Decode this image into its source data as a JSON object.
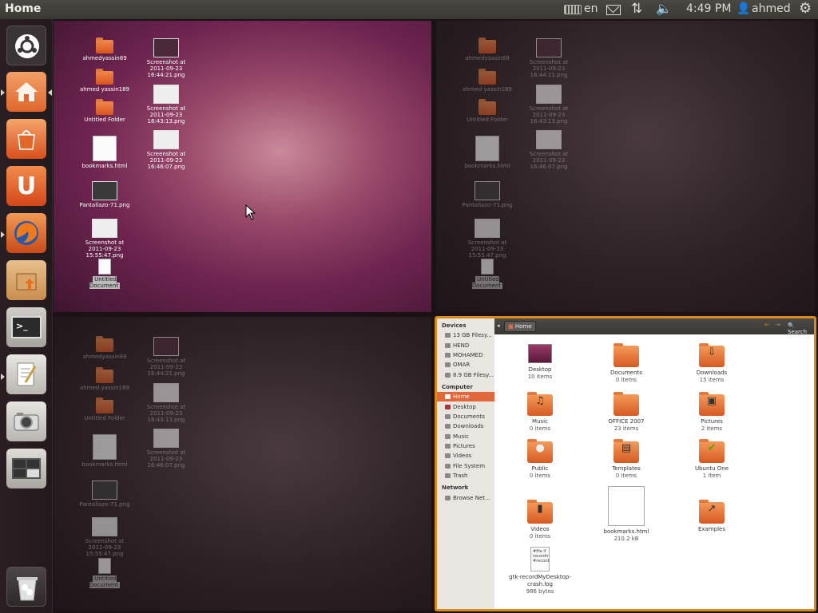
{
  "panel": {
    "title": "Home",
    "keyboard_layout": "en",
    "time": "4:49 PM",
    "user": "ahmed"
  },
  "launcher": {
    "items": [
      {
        "name": "ubuntu-logo"
      },
      {
        "name": "home-folder"
      },
      {
        "name": "software-center"
      },
      {
        "name": "ubuntu-one"
      },
      {
        "name": "firefox"
      },
      {
        "name": "archive-manager"
      },
      {
        "name": "terminal"
      },
      {
        "name": "text-editor"
      },
      {
        "name": "cheese-webcam"
      },
      {
        "name": "workspace-switcher"
      },
      {
        "name": "trash"
      }
    ]
  },
  "desktop": {
    "icons": [
      {
        "label": "ahmedyassin89",
        "kind": "folder"
      },
      {
        "label": "ahmed yassin189",
        "kind": "folder"
      },
      {
        "label": "Untitled Folder",
        "kind": "folder"
      },
      {
        "label": "bookmarks.html",
        "kind": "doc"
      },
      {
        "label": "Pantallazo-71.png",
        "kind": "image"
      },
      {
        "label": "Screenshot at 2011-09-23 15:55:47.png",
        "kind": "image"
      },
      {
        "label": "Untitled Document",
        "kind": "text"
      },
      {
        "label": "Screenshot at 2011-09-23 16:44:21.png",
        "kind": "image"
      },
      {
        "label": "Screenshot at 2011-09-23 16:43:13.png",
        "kind": "image"
      },
      {
        "label": "Screenshot at 2011-09-23 16:46:07.png",
        "kind": "image"
      }
    ]
  },
  "file_manager": {
    "sidebar": {
      "devices_header": "Devices",
      "devices": [
        "13 GB Filesy...",
        "HEND",
        "MOHAMED",
        "OMAR",
        "8.9 GB Filesy..."
      ],
      "computer_header": "Computer",
      "computer": [
        "Home",
        "Desktop",
        "Documents",
        "Downloads",
        "Music",
        "Pictures",
        "Videos",
        "File System",
        "Trash"
      ],
      "network_header": "Network",
      "network": [
        "Browse Net..."
      ]
    },
    "location": "Home",
    "search_label": "Search",
    "items": [
      {
        "name": "Desktop",
        "sub": "10 items"
      },
      {
        "name": "Documents",
        "sub": "0 items"
      },
      {
        "name": "Downloads",
        "sub": "15 items"
      },
      {
        "name": "Music",
        "sub": "0 items"
      },
      {
        "name": "OFFICE 2007",
        "sub": "23 items"
      },
      {
        "name": "Pictures",
        "sub": "2 items"
      },
      {
        "name": "Public",
        "sub": "0 items"
      },
      {
        "name": "Templates",
        "sub": "0 items"
      },
      {
        "name": "Ubuntu One",
        "sub": "1 item"
      },
      {
        "name": "Videos",
        "sub": "0 items"
      },
      {
        "name": "bookmarks.html",
        "sub": "210.2 kB"
      },
      {
        "name": "Examples",
        "sub": ""
      },
      {
        "name": "gtk-recordMyDesktop-crash.log",
        "sub": "986 bytes"
      }
    ],
    "log_preview": "#file if\nrecordmy\n#record"
  }
}
